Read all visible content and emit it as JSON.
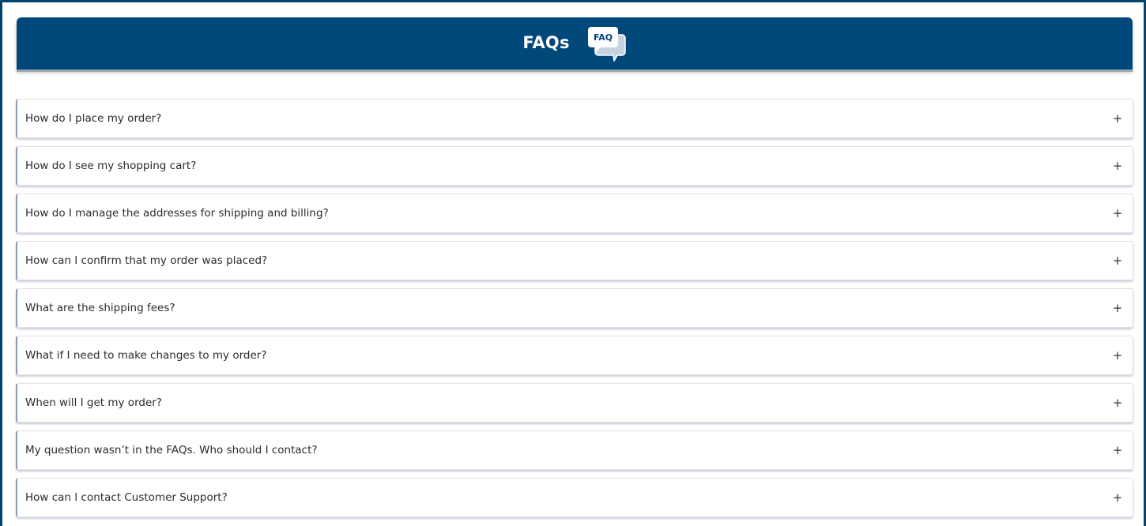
{
  "header": {
    "title": "FAQs",
    "icon": "faq-speech-bubbles-icon",
    "icon_text": "FAQ"
  },
  "faq": {
    "expand_symbol": "+",
    "items": [
      {
        "question": "How do I place my order?"
      },
      {
        "question": "How do I see my shopping cart?"
      },
      {
        "question": "How do I manage the addresses for shipping and billing?"
      },
      {
        "question": "How can I confirm that my order was placed?"
      },
      {
        "question": "What are the shipping fees?"
      },
      {
        "question": "What if I need to make changes to my order?"
      },
      {
        "question": "When will I get my order?"
      },
      {
        "question": "My question wasn’t in the FAQs. Who should I contact?"
      },
      {
        "question": "How can I contact Customer Support?"
      }
    ]
  },
  "colors": {
    "header_bg": "#00477a",
    "frame_border": "#00446f",
    "text": "#2b2b2b"
  }
}
